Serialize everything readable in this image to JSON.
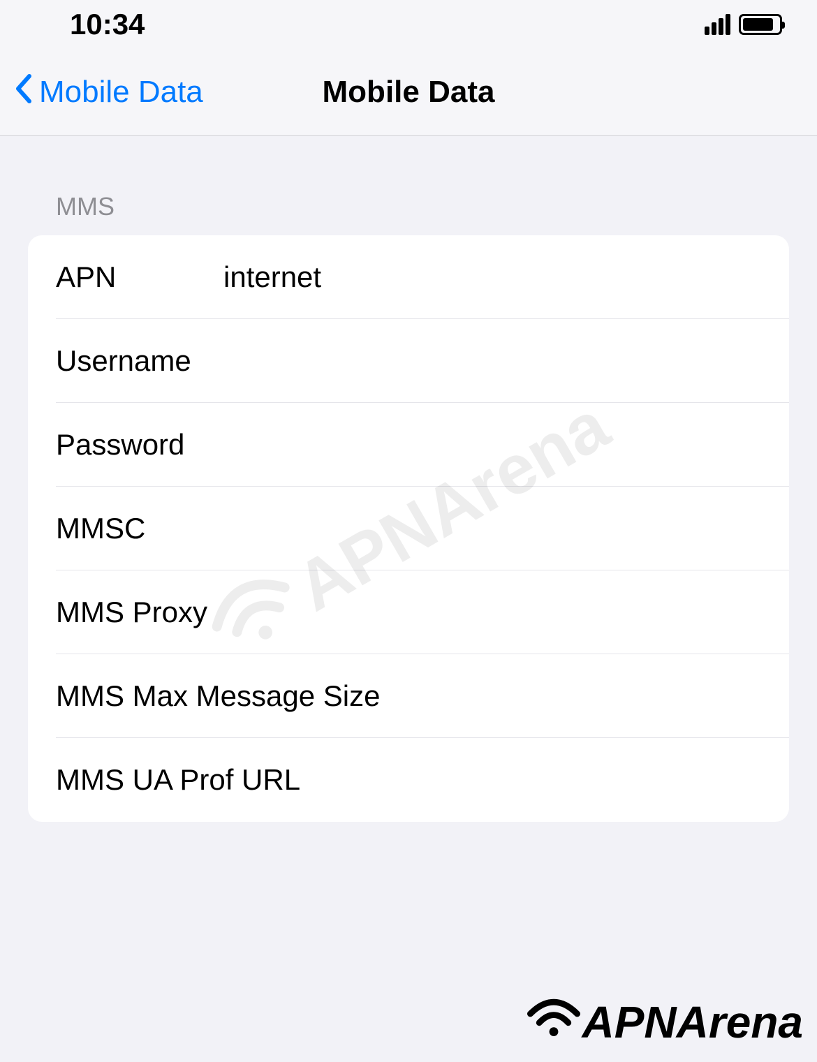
{
  "statusBar": {
    "time": "10:34"
  },
  "navBar": {
    "backLabel": "Mobile Data",
    "title": "Mobile Data"
  },
  "section": {
    "header": "MMS",
    "rows": [
      {
        "label": "APN",
        "value": "internet"
      },
      {
        "label": "Username",
        "value": ""
      },
      {
        "label": "Password",
        "value": ""
      },
      {
        "label": "MMSC",
        "value": ""
      },
      {
        "label": "MMS Proxy",
        "value": ""
      },
      {
        "label": "MMS Max Message Size",
        "value": ""
      },
      {
        "label": "MMS UA Prof URL",
        "value": ""
      }
    ]
  },
  "watermark": {
    "text": "APNArena"
  },
  "footer": {
    "logoText": "APNArena"
  }
}
